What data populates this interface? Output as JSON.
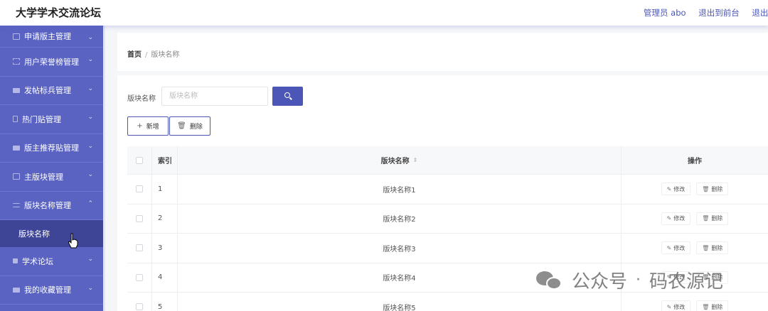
{
  "header": {
    "brand": "大学学术交流论坛",
    "admin": "管理员 abo",
    "to_front": "退出到前台",
    "logout": "退出登录"
  },
  "sidebar": {
    "items": [
      {
        "label": "申请版主管理",
        "icon": "mail-icon"
      },
      {
        "label": "用户荣誉榜管理",
        "icon": "frame-icon"
      },
      {
        "label": "发帖标兵管理",
        "icon": "doc-icon"
      },
      {
        "label": "热门贴管理",
        "icon": "phone-icon"
      },
      {
        "label": "版主推荐贴管理",
        "icon": "monitor-icon"
      },
      {
        "label": "主版块管理",
        "icon": "mail-icon"
      },
      {
        "label": "版块名称管理",
        "icon": "list-icon",
        "expanded": true
      },
      {
        "label": "学术论坛",
        "icon": "trophy-icon"
      },
      {
        "label": "我的收藏管理",
        "icon": "chat-icon"
      }
    ],
    "active_sub": "版块名称"
  },
  "breadcrumb": {
    "home": "首页",
    "separator": "/",
    "current": "版块名称"
  },
  "search": {
    "label": "版块名称",
    "placeholder": "版块名称"
  },
  "toolbar": {
    "add_label": "新增",
    "delete_label": "删除"
  },
  "table": {
    "headers": {
      "index": "索引",
      "name": "版块名称",
      "ops": "操作"
    },
    "edit_label": "修改",
    "delete_label": "删除",
    "rows": [
      {
        "index": "1",
        "name": "版块名称1"
      },
      {
        "index": "2",
        "name": "版块名称2"
      },
      {
        "index": "3",
        "name": "版块名称3"
      },
      {
        "index": "4",
        "name": "版块名称4"
      },
      {
        "index": "5",
        "name": "版块名称5"
      }
    ]
  },
  "watermark": {
    "left": "公众号",
    "dot": "·",
    "right": "码农源记"
  },
  "colors": {
    "primary": "#4b56b6",
    "sidebar": "#5a63c2",
    "sidebar_active": "#3e4597"
  }
}
